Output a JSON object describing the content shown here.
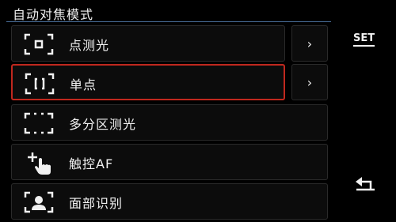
{
  "header": {
    "title": "自动对焦模式"
  },
  "menu": {
    "items": [
      {
        "label": "点测光",
        "icon": "center-point-af-icon",
        "has_arrow": true,
        "selected": false
      },
      {
        "label": "单点",
        "icon": "single-point-af-icon",
        "has_arrow": true,
        "selected": true
      },
      {
        "label": "多分区测光",
        "icon": "multi-zone-af-icon",
        "has_arrow": false,
        "selected": false
      },
      {
        "label": "触控AF",
        "icon": "touch-af-icon",
        "has_arrow": false,
        "selected": false
      },
      {
        "label": "面部识别",
        "icon": "face-detection-icon",
        "has_arrow": false,
        "selected": false
      }
    ],
    "arrow_glyph": "›"
  },
  "side": {
    "set_label": "SET",
    "back_icon": "return-arrow-icon"
  },
  "colors": {
    "selection": "#c0281e",
    "accent_rule": "#4a6f9a"
  }
}
